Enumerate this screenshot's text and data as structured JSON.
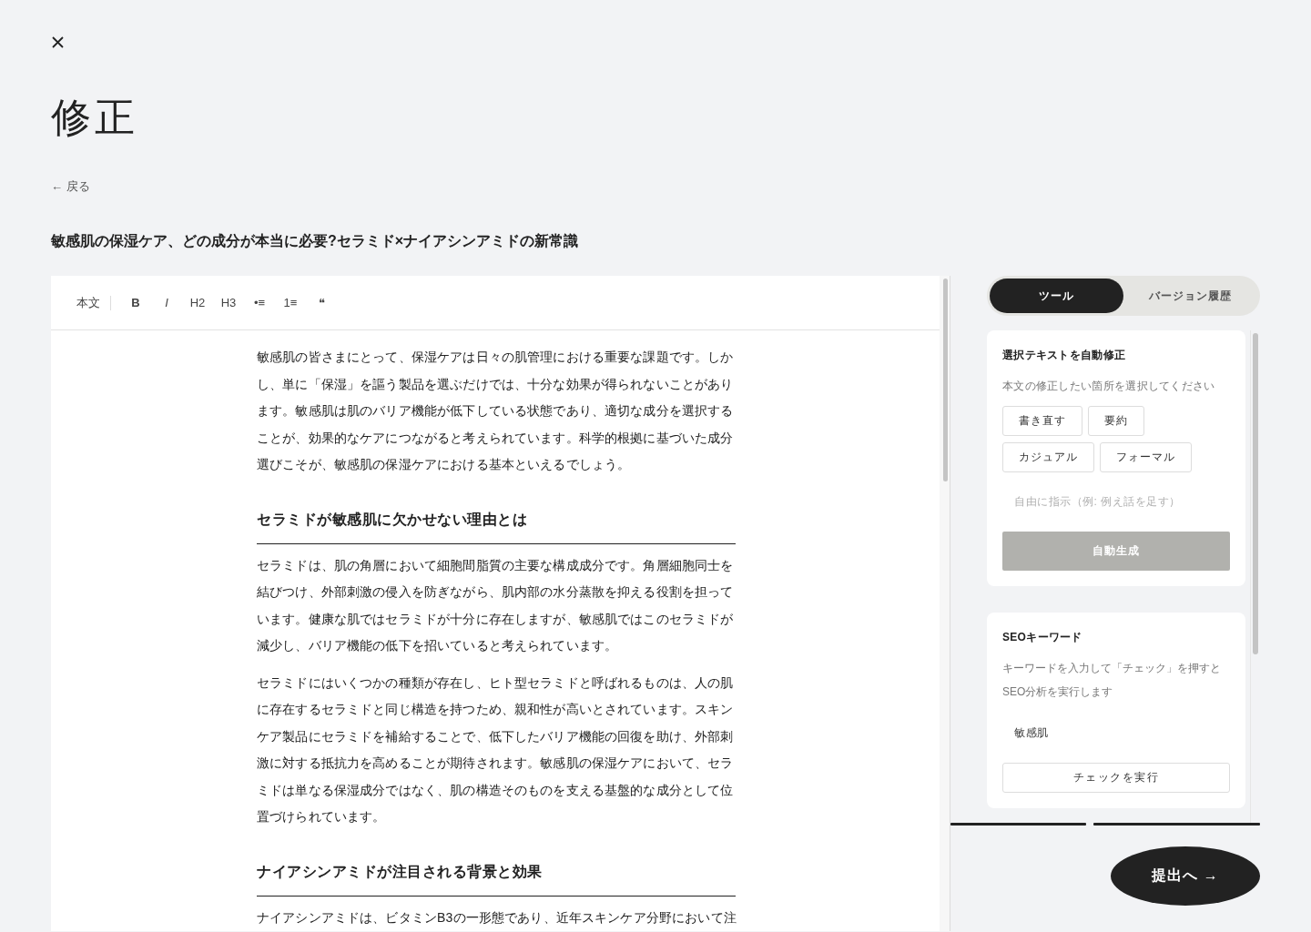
{
  "title": "修正",
  "back_link": {
    "label": "← 戻る"
  },
  "article_title": "敏感肌の保湿ケア、どの成分が本当に必要?セラミド×ナイアシンアミドの新常識",
  "editor": {
    "toolbar": [
      {
        "kind": "style",
        "label": "本文"
      },
      {
        "kind": "bold",
        "label": "B"
      },
      {
        "kind": "italic",
        "label": "I"
      },
      {
        "kind": "plain",
        "label": "H2"
      },
      {
        "kind": "plain",
        "label": "H3"
      },
      {
        "kind": "plain",
        "label": "•≡"
      },
      {
        "kind": "plain",
        "label": "1≡"
      },
      {
        "kind": "plain",
        "label": "❝"
      }
    ],
    "content": [
      {
        "kind": "paragraph",
        "text": "敏感肌の皆さまにとって、保湿ケアは日々の肌管理における重要な課題です。しかし、単に「保湿」を謳う製品を選ぶだけでは、十分な効果が得られないことがあります。敏感肌は肌のバリア機能が低下している状態であり、適切な成分を選択することが、効果的なケアにつながると考えられています。科学的根拠に基づいた成分選びこそが、敏感肌の保湿ケアにおける基本といえるでしょう。"
      },
      {
        "kind": "heading",
        "text": "セラミドが敏感肌に欠かせない理由とは"
      },
      {
        "kind": "paragraph",
        "text": "セラミドは、肌の角層において細胞間脂質の主要な構成成分です。角層細胞同士を結びつけ、外部刺激の侵入を防ぎながら、肌内部の水分蒸散を抑える役割を担っています。健康な肌ではセラミドが十分に存在しますが、敏感肌ではこのセラミドが減少し、バリア機能の低下を招いていると考えられています。"
      },
      {
        "kind": "paragraph",
        "text": "セラミドにはいくつかの種類が存在し、ヒト型セラミドと呼ばれるものは、人の肌に存在するセラミドと同じ構造を持つため、親和性が高いとされています。スキンケア製品にセラミドを補給することで、低下したバリア機能の回復を助け、外部刺激に対する抵抗力を高めることが期待されます。敏感肌の保湿ケアにおいて、セラミドは単なる保湿成分ではなく、肌の構造そのものを支える基盤的な成分として位置づけられています。"
      },
      {
        "kind": "heading",
        "text": "ナイアシンアミドが注目される背景と効果"
      },
      {
        "kind": "paragraph",
        "text": "ナイアシンアミドは、ビタミンB3の一形態であり、近年スキンケア分野において注"
      }
    ]
  },
  "side_panel": {
    "tabs": [
      {
        "label": "ツール",
        "selected": true
      },
      {
        "label": "バージョン履歴",
        "selected": false
      }
    ],
    "cards": [
      {
        "kind": "rewrite",
        "title": "選択テキストを自動修正",
        "description": "本文の修正したい箇所を選択してください",
        "options": [
          "書き直す",
          "要約",
          "カジュアル",
          "フォーマル"
        ],
        "field": {
          "placeholder": "自由に指示（例: 例え話を足す）"
        },
        "action": {
          "label": "自動生成",
          "disabled": true
        }
      },
      {
        "kind": "seo",
        "title": "SEOキーワード",
        "description": "キーワードを入力して「チェック」を押すとSEO分析を実行します",
        "field": {
          "value": "敏感肌"
        },
        "action": {
          "label": "チェックを実行",
          "disabled": false
        }
      }
    ]
  },
  "submit_button": {
    "label": "提出へ →"
  }
}
